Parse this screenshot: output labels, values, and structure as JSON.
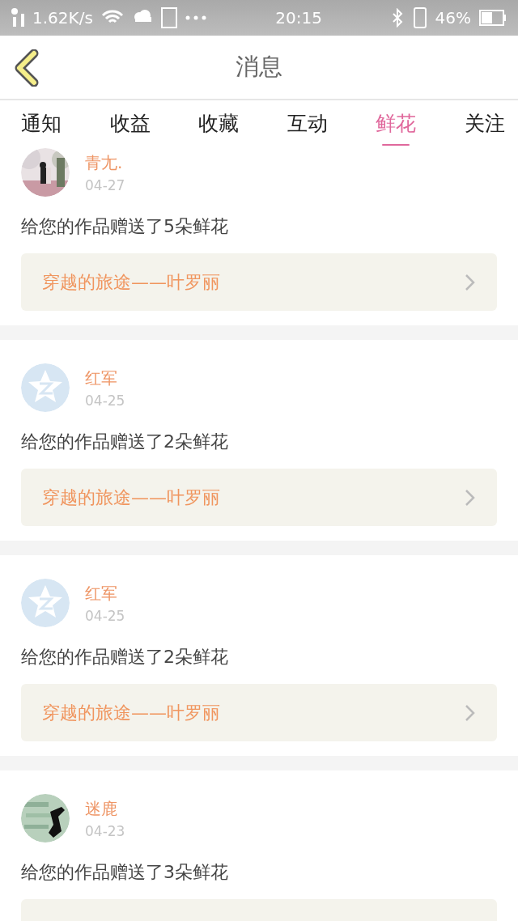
{
  "status_bar": {
    "speed": "1.62K/s",
    "time": "20:15",
    "battery": "46%"
  },
  "header": {
    "title": "消息"
  },
  "tabs": [
    {
      "label": "通知",
      "selected": false
    },
    {
      "label": "收益",
      "selected": false
    },
    {
      "label": "收藏",
      "selected": false
    },
    {
      "label": "互动",
      "selected": false
    },
    {
      "label": "鲜花",
      "selected": true
    },
    {
      "label": "关注",
      "selected": false
    }
  ],
  "messages": [
    {
      "name": "青尢.",
      "date": "04-27",
      "text": "给您的作品赠送了5朵鲜花",
      "work": "穿越的旅途——叶罗丽"
    },
    {
      "avatar": {
        "kind": "default"
      },
      "name": "红军",
      "date": "04-25",
      "text": "给您的作品赠送了2朵鲜花",
      "work": "穿越的旅途——叶罗丽"
    },
    {
      "avatar": {
        "kind": "default"
      },
      "name": "红军",
      "date": "04-25",
      "text": "给您的作品赠送了2朵鲜花",
      "work": "穿越的旅途——叶罗丽"
    },
    {
      "name": "迷鹿",
      "date": "04-23",
      "text": "给您的作品赠送了3朵鲜花"
    }
  ]
}
